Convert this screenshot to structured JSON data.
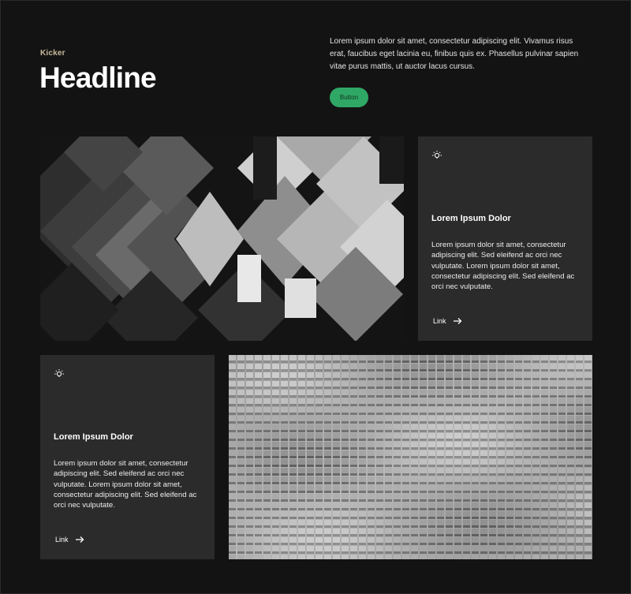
{
  "header": {
    "kicker": "Kicker",
    "headline": "Headline",
    "intro": "Lorem ipsum dolor sit amet, consectetur adipiscing elit. Vivamus risus erat, faucibus eget lacinia eu, finibus quis ex. Phasellus pulvinar sapien vitae purus mattis, ut auctor lacus cursus.",
    "button_label": "Button"
  },
  "cards": [
    {
      "icon": "lightbulb-icon",
      "title": "Lorem Ipsum Dolor",
      "body": "Lorem ipsum dolor sit amet, consectetur adipiscing elit. Sed eleifend ac orci nec vulputate. Lorem ipsum dolor sit amet, consectetur adipiscing elit. Sed eleifend ac orci nec vulputate.",
      "link_label": "Link"
    },
    {
      "icon": "lightbulb-icon",
      "title": "Lorem Ipsum Dolor",
      "body": "Lorem ipsum dolor sit amet, consectetur adipiscing elit. Sed eleifend ac orci nec vulputate. Lorem ipsum dolor sit amet, consectetur adipiscing elit. Sed eleifend ac orci nec vulputate.",
      "link_label": "Link"
    }
  ],
  "colors": {
    "background": "#131313",
    "card": "#2b2b2b",
    "accent_button": "#2fa866",
    "kicker": "#c9b99c"
  }
}
